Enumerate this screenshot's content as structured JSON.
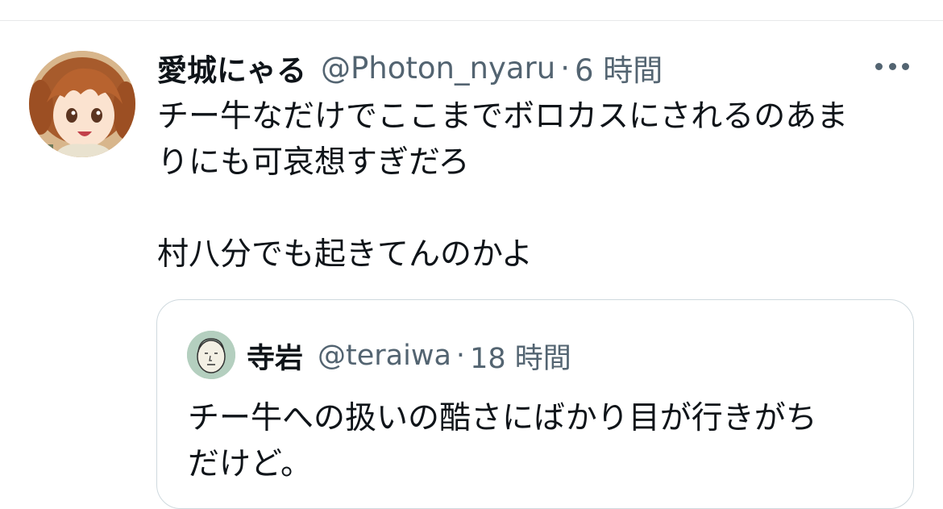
{
  "tweet": {
    "author": {
      "display_name": "愛城にゃる",
      "handle": "@Photon_nyaru",
      "avatar": "anime-girl-avatar"
    },
    "separator": "·",
    "time": "6 時間",
    "more_icon": "more-horizontal-icon",
    "text": {
      "paragraph_1_line_1": "チー牛なだけでここまでボロカスにされるのあま",
      "paragraph_1_line_2": "りにも可哀想すぎだろ",
      "paragraph_2": "村八分でも起きてんのかよ"
    }
  },
  "quoted_tweet": {
    "author": {
      "display_name": "寺岩",
      "handle": "@teraiwa",
      "avatar": "cartoon-face-avatar"
    },
    "separator": "·",
    "time": "18 時間",
    "text": {
      "line_1": "チー牛への扱いの酷さにばかり目が行きがち",
      "line_2": "だけど。"
    }
  },
  "colors": {
    "primary_text": "#0f1419",
    "secondary_text": "#536471",
    "border": "#cfd9de",
    "divider": "#e7e9ea",
    "quote_avatar_bg": "#b4cfbf"
  }
}
